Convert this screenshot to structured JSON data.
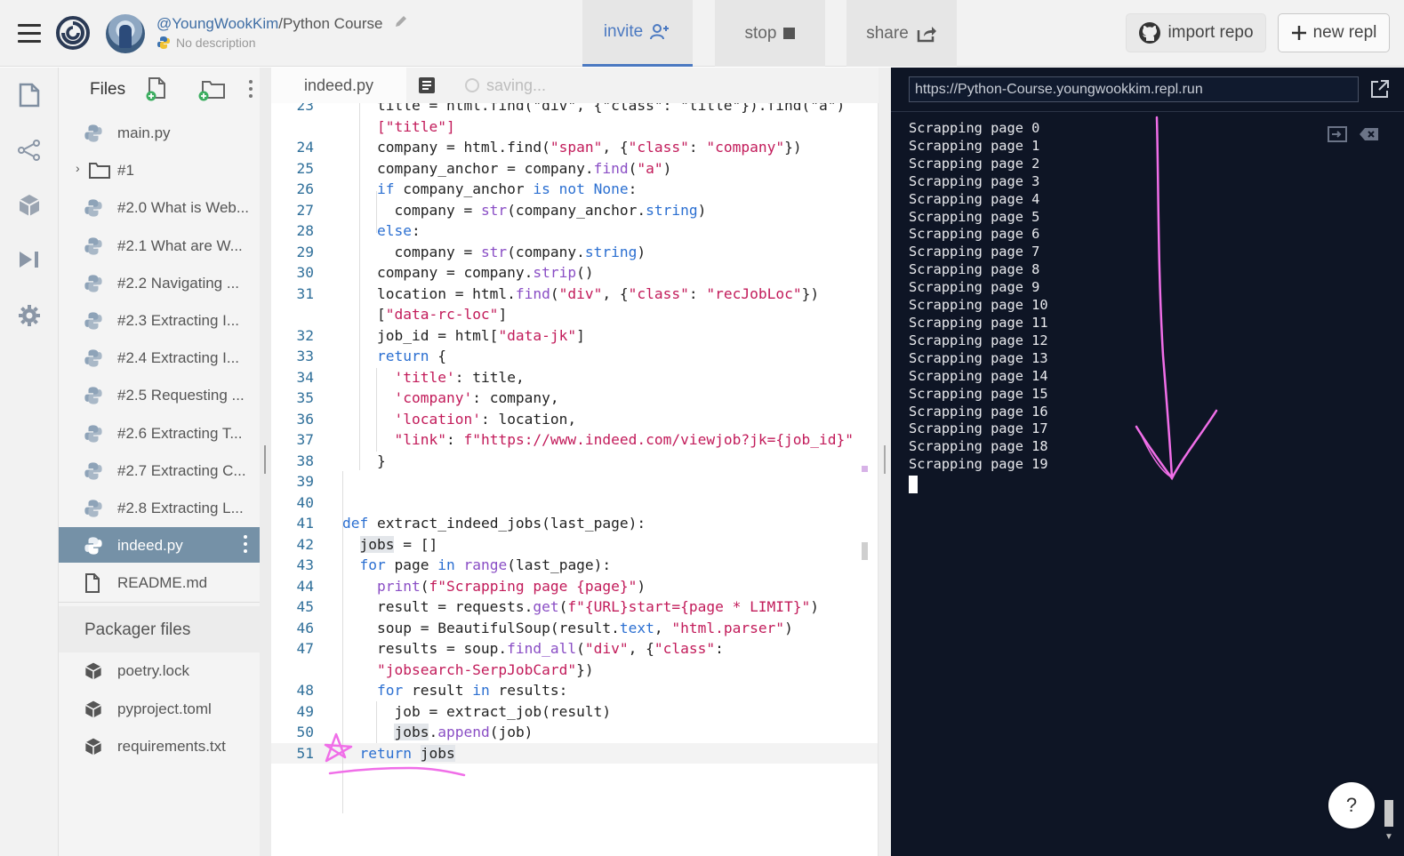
{
  "header": {
    "owner": "@YoungWookKim",
    "separator": "/",
    "repl_name": "Python Course",
    "description": "No description",
    "invite_label": "invite",
    "stop_label": "stop",
    "share_label": "share",
    "import_label": "import repo",
    "new_repl_label": "new repl"
  },
  "files": {
    "title": "Files",
    "items": [
      {
        "label": "main.py",
        "icon": "python-icon"
      },
      {
        "label": "#1",
        "icon": "folder-icon"
      },
      {
        "label": "#2.0 What is Web...",
        "icon": "python-icon"
      },
      {
        "label": "#2.1 What are W...",
        "icon": "python-icon"
      },
      {
        "label": "#2.2 Navigating ...",
        "icon": "python-icon"
      },
      {
        "label": "#2.3 Extracting I...",
        "icon": "python-icon"
      },
      {
        "label": "#2.4 Extracting I...",
        "icon": "python-icon"
      },
      {
        "label": "#2.5 Requesting ...",
        "icon": "python-icon"
      },
      {
        "label": "#2.6 Extracting T...",
        "icon": "python-icon"
      },
      {
        "label": "#2.7 Extracting C...",
        "icon": "python-icon"
      },
      {
        "label": "#2.8 Extracting L...",
        "icon": "python-icon"
      },
      {
        "label": "indeed.py",
        "icon": "python-icon",
        "active": true
      },
      {
        "label": "README.md",
        "icon": "document-icon"
      }
    ],
    "packager_title": "Packager files",
    "packager_items": [
      {
        "label": "poetry.lock",
        "icon": "package-icon"
      },
      {
        "label": "pyproject.toml",
        "icon": "package-icon"
      },
      {
        "label": "requirements.txt",
        "icon": "package-icon"
      }
    ]
  },
  "editor": {
    "tab_label": "indeed.py",
    "status": "saving...",
    "current_line": "51",
    "lines": [
      {
        "n": "23",
        "tokens": [
          [
            "",
            "    title = html.find(\"div\", {\"class\": \"title\"}).find(\"a\")"
          ]
        ]
      },
      {
        "n": "",
        "tokens": [
          [
            "",
            "    "
          ],
          [
            "st",
            "[\"title\"]"
          ]
        ]
      },
      {
        "n": "24",
        "tokens": [
          [
            "",
            "    company = html.find("
          ],
          [
            "st",
            "\"span\""
          ],
          [
            "",
            ", {"
          ],
          [
            "st",
            "\"class\""
          ],
          [
            "",
            ": "
          ],
          [
            "st",
            "\"company\""
          ],
          [
            "",
            "})"
          ]
        ]
      },
      {
        "n": "25",
        "tokens": [
          [
            "",
            "    company_anchor = company."
          ],
          [
            "fn",
            "find"
          ],
          [
            "",
            "("
          ],
          [
            "st",
            "\"a\""
          ],
          [
            "",
            ")"
          ]
        ]
      },
      {
        "n": "26",
        "tokens": [
          [
            "",
            "    "
          ],
          [
            "kw",
            "if"
          ],
          [
            "",
            " company_anchor "
          ],
          [
            "kw",
            "is not None"
          ],
          [
            "",
            ":"
          ]
        ]
      },
      {
        "n": "27",
        "tokens": [
          [
            "",
            "      company = "
          ],
          [
            "fn",
            "str"
          ],
          [
            "",
            "(company_anchor."
          ],
          [
            "kw",
            "string"
          ],
          [
            "",
            ")"
          ]
        ]
      },
      {
        "n": "28",
        "tokens": [
          [
            "",
            "    "
          ],
          [
            "kw",
            "else"
          ],
          [
            "",
            ":"
          ]
        ]
      },
      {
        "n": "29",
        "tokens": [
          [
            "",
            "      company = "
          ],
          [
            "fn",
            "str"
          ],
          [
            "",
            "(company."
          ],
          [
            "kw",
            "string"
          ],
          [
            "",
            ")"
          ]
        ]
      },
      {
        "n": "30",
        "tokens": [
          [
            "",
            "    company = company."
          ],
          [
            "fn",
            "strip"
          ],
          [
            "",
            "()"
          ]
        ]
      },
      {
        "n": "31",
        "tokens": [
          [
            "",
            "    location = html."
          ],
          [
            "fn",
            "find"
          ],
          [
            "",
            "("
          ],
          [
            "st",
            "\"div\""
          ],
          [
            "",
            ", {"
          ],
          [
            "st",
            "\"class\""
          ],
          [
            "",
            ": "
          ],
          [
            "st",
            "\"recJobLoc\""
          ],
          [
            "",
            "})"
          ]
        ]
      },
      {
        "n": "",
        "tokens": [
          [
            "",
            "    ["
          ],
          [
            "st",
            "\"data-rc-loc\""
          ],
          [
            "",
            "]"
          ]
        ]
      },
      {
        "n": "32",
        "tokens": [
          [
            "",
            "    job_id = html["
          ],
          [
            "st",
            "\"data-jk\""
          ],
          [
            "",
            "]"
          ]
        ]
      },
      {
        "n": "33",
        "tokens": [
          [
            "",
            "    "
          ],
          [
            "kw",
            "return"
          ],
          [
            "",
            " {"
          ]
        ]
      },
      {
        "n": "34",
        "tokens": [
          [
            "",
            "      "
          ],
          [
            "st",
            "'title'"
          ],
          [
            "",
            ": title,"
          ]
        ]
      },
      {
        "n": "35",
        "tokens": [
          [
            "",
            "      "
          ],
          [
            "st",
            "'company'"
          ],
          [
            "",
            ": company,"
          ]
        ]
      },
      {
        "n": "36",
        "tokens": [
          [
            "",
            "      "
          ],
          [
            "st",
            "'location'"
          ],
          [
            "",
            ": location,"
          ]
        ]
      },
      {
        "n": "37",
        "tokens": [
          [
            "",
            "      "
          ],
          [
            "st",
            "\"link\""
          ],
          [
            "",
            ": "
          ],
          [
            "st",
            "f\"https://www.indeed.com/viewjob?jk={job_id}\""
          ]
        ]
      },
      {
        "n": "38",
        "tokens": [
          [
            "",
            "    }"
          ]
        ]
      },
      {
        "n": "39",
        "tokens": [
          [
            "",
            ""
          ]
        ]
      },
      {
        "n": "40",
        "tokens": [
          [
            "",
            ""
          ]
        ]
      },
      {
        "n": "41",
        "tokens": [
          [
            "kw",
            "def"
          ],
          [
            "",
            " extract_indeed_jobs(last_page):"
          ]
        ]
      },
      {
        "n": "42",
        "tokens": [
          [
            "",
            "  "
          ],
          [
            "hl",
            "jobs"
          ],
          [
            "",
            " = []"
          ]
        ]
      },
      {
        "n": "43",
        "tokens": [
          [
            "",
            "  "
          ],
          [
            "kw",
            "for"
          ],
          [
            "",
            " page "
          ],
          [
            "kw",
            "in"
          ],
          [
            "",
            " "
          ],
          [
            "fn",
            "range"
          ],
          [
            "",
            "(last_page):"
          ]
        ]
      },
      {
        "n": "44",
        "tokens": [
          [
            "",
            "    "
          ],
          [
            "fn",
            "print"
          ],
          [
            "",
            "("
          ],
          [
            "st",
            "f\"Scrapping page {page}\""
          ],
          [
            "",
            ")"
          ]
        ]
      },
      {
        "n": "45",
        "tokens": [
          [
            "",
            "    result = requests."
          ],
          [
            "fn",
            "get"
          ],
          [
            "",
            "("
          ],
          [
            "st",
            "f\"{URL}start={page * LIMIT}\""
          ],
          [
            "",
            ")"
          ]
        ]
      },
      {
        "n": "46",
        "tokens": [
          [
            "",
            "    soup = BeautifulSoup(result."
          ],
          [
            "kw",
            "text"
          ],
          [
            "",
            ", "
          ],
          [
            "st",
            "\"html.parser\""
          ],
          [
            "",
            ")"
          ]
        ]
      },
      {
        "n": "47",
        "tokens": [
          [
            "",
            "    results = soup."
          ],
          [
            "fn",
            "find_all"
          ],
          [
            "",
            "("
          ],
          [
            "st",
            "\"div\""
          ],
          [
            "",
            ", {"
          ],
          [
            "st",
            "\"class\""
          ],
          [
            "",
            ":"
          ]
        ]
      },
      {
        "n": "",
        "tokens": [
          [
            "",
            "    "
          ],
          [
            "st",
            "\"jobsearch-SerpJobCard\""
          ],
          [
            "",
            "})"
          ]
        ]
      },
      {
        "n": "48",
        "tokens": [
          [
            "",
            "    "
          ],
          [
            "kw",
            "for"
          ],
          [
            "",
            " result "
          ],
          [
            "kw",
            "in"
          ],
          [
            "",
            " results:"
          ]
        ]
      },
      {
        "n": "49",
        "tokens": [
          [
            "",
            "      job = extract_job(result)"
          ]
        ]
      },
      {
        "n": "50",
        "tokens": [
          [
            "",
            "      "
          ],
          [
            "hl",
            "jobs"
          ],
          [
            "",
            "."
          ],
          [
            "fn",
            "append"
          ],
          [
            "",
            "(job)"
          ]
        ]
      },
      {
        "n": "51",
        "tokens": [
          [
            "",
            "  "
          ],
          [
            "kw",
            "return"
          ],
          [
            "",
            " "
          ],
          [
            "hl",
            "jobs"
          ]
        ]
      }
    ]
  },
  "console": {
    "url": "https://Python-Course.youngwookkim.repl.run",
    "output": [
      "Scrapping page 0",
      "Scrapping page 1",
      "Scrapping page 2",
      "Scrapping page 3",
      "Scrapping page 4",
      "Scrapping page 5",
      "Scrapping page 6",
      "Scrapping page 7",
      "Scrapping page 8",
      "Scrapping page 9",
      "Scrapping page 10",
      "Scrapping page 11",
      "Scrapping page 12",
      "Scrapping page 13",
      "Scrapping page 14",
      "Scrapping page 15",
      "Scrapping page 16",
      "Scrapping page 17",
      "Scrapping page 18",
      "Scrapping page 19"
    ],
    "help_label": "?"
  },
  "colors": {
    "accent": "#4b79c1",
    "console_bg": "#0e1525",
    "annotation": "#f06ee8",
    "active_file_bg": "#7591a7"
  }
}
